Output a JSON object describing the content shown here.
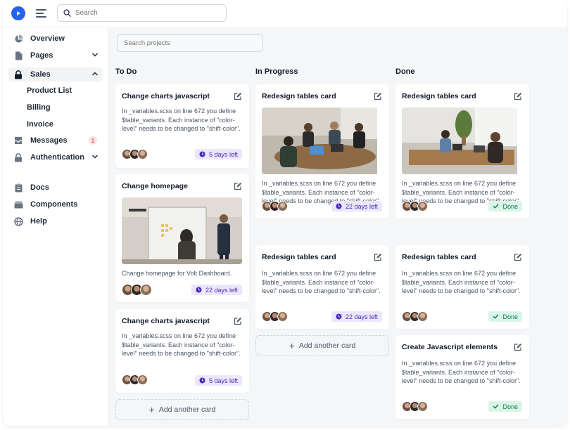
{
  "header": {
    "search_placeholder": "Search"
  },
  "sidebar": {
    "items": [
      {
        "label": "Overview",
        "icon": "pie-chart-icon"
      },
      {
        "label": "Pages",
        "icon": "document-icon"
      },
      {
        "label": "Sales",
        "icon": "lock-icon"
      },
      {
        "label": "Messages",
        "icon": "inbox-icon",
        "badge": "1"
      },
      {
        "label": "Authentication",
        "icon": "lock-icon"
      },
      {
        "label": "Docs",
        "icon": "clipboard-icon"
      },
      {
        "label": "Components",
        "icon": "archive-icon"
      },
      {
        "label": "Help",
        "icon": "globe-icon"
      }
    ],
    "sales_sub": [
      "Product List",
      "Billing",
      "Invoice"
    ]
  },
  "main": {
    "search_placeholder": "Search projects"
  },
  "board": {
    "columns": [
      {
        "title": "To Do",
        "add_label": "Add another card",
        "cards": [
          {
            "title": "Change charts javascript",
            "text": "In _variables.scss on line 672 you define $table_variants. Each instance of \"color-level\" needs to be changed to \"shift-color\".",
            "tag": "5 days left"
          },
          {
            "title": "Change homepage",
            "text": "Change homepage for Volt Dashboard.",
            "tag": "22 days left"
          },
          {
            "title": "Change charts javascript",
            "text": "In _variables.scss on line 672 you define $table_variants. Each instance of \"color-level\" needs to be changed to \"shift-color\".",
            "tag": "5 days left"
          }
        ]
      },
      {
        "title": "In Progress",
        "add_label": "Add another card",
        "cards": [
          {
            "title": "Redesign tables card",
            "text": "In _variables.scss on line 672 you define $table_variants. Each instance of \"color-level\" needs to be changed to \"shift-color\".",
            "tag": "22 days left"
          },
          {
            "title": "Redesign tables card",
            "text": "In _variables.scss on line 672 you define $table_variants. Each instance of \"color-level\" needs to be changed to \"shift-color\".",
            "tag": "22 days left"
          }
        ]
      },
      {
        "title": "Done",
        "cards": [
          {
            "title": "Redesign tables card",
            "text": "In _variables.scss on line 672 you define $table_variants. Each instance of \"color-level\" needs to be changed to \"shift-color\".",
            "tag": "Done"
          },
          {
            "title": "Redesign tables card",
            "text": "In _variables.scss on line 672 you define $table_variants. Each instance of \"color-level\" needs to be changed to \"shift-color\".",
            "tag": "Done"
          },
          {
            "title": "Create Javascript elements",
            "text": "In _variables.scss on line 672 you define $table_variants. Each instance of \"color-level\" needs to be changed to \"shift-color\".",
            "tag": "Done"
          }
        ]
      }
    ]
  },
  "colors": {
    "brand": "#2563eb",
    "time_tag_bg": "#ebe7fb",
    "time_tag_fg": "#4c2bb8",
    "done_tag_bg": "#daf5e8",
    "done_tag_fg": "#0e7a4d"
  }
}
